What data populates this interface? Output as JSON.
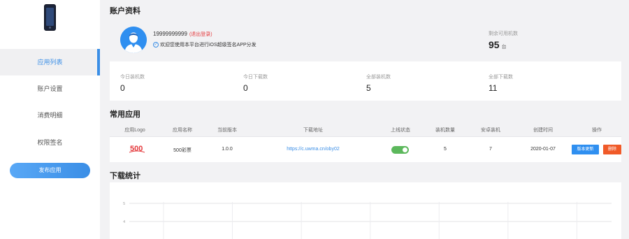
{
  "sidebar": {
    "items": [
      {
        "label": "应用列表",
        "active": true
      },
      {
        "label": "账户设置",
        "active": false
      },
      {
        "label": "消费明细",
        "active": false
      },
      {
        "label": "权限签名",
        "active": false
      }
    ],
    "publish_label": "发布应用"
  },
  "account": {
    "title": "账户资料",
    "phone": "19999999999",
    "bind_link": "(退出登录)",
    "notice": "欢迎您使用本平台进行iOS超级签名APP分发",
    "remaining_label": "剩余可用机数",
    "remaining_value": "95",
    "remaining_unit": "台",
    "stats": [
      {
        "label": "今日装机数",
        "value": "0"
      },
      {
        "label": "今日下载数",
        "value": "0"
      },
      {
        "label": "全部装机数",
        "value": "5"
      },
      {
        "label": "全部下载数",
        "value": "11"
      }
    ]
  },
  "apps": {
    "title": "常用应用",
    "columns": [
      "应用Logo",
      "应用名称",
      "当前版本",
      "下载地址",
      "上线状态",
      "装机数量",
      "安卓装机",
      "创建时间",
      "操作"
    ],
    "rows": [
      {
        "logo_text": "500",
        "name": "500彩票",
        "version": "1.0.0",
        "url": "https://c.uwma.cn/oby02",
        "online": true,
        "installs": "5",
        "android_installs": "7",
        "created": "2020-01-07",
        "action_edit": "版本更新",
        "action_delete": "删除"
      }
    ]
  },
  "downloads": {
    "title": "下载统计",
    "chart_data": {
      "type": "line",
      "title": "",
      "y_ticks": [
        "5",
        "4"
      ],
      "grid": true,
      "series": []
    }
  },
  "colors": {
    "accent": "#3a8ee6",
    "danger": "#f05a28",
    "success": "#5cb85c"
  }
}
